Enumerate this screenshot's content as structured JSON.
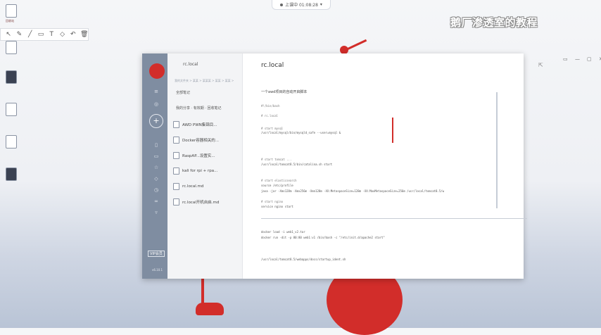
{
  "recorder": {
    "status_text": "上课中 01:08:28",
    "chevron": "▾"
  },
  "overlay_title": "鹅厂渗透室的教程",
  "anno_toolbar": {
    "tools": [
      "↖",
      "✎",
      "╱",
      "▭",
      "T",
      "◇",
      "↶",
      "🗑"
    ]
  },
  "desktop": {
    "icons": [
      {
        "label": "回收站"
      },
      {
        "label": ""
      },
      {
        "label": ""
      },
      {
        "label": ""
      },
      {
        "label": ""
      },
      {
        "label": ""
      }
    ]
  },
  "app": {
    "notebook_title": "rc.local",
    "crumb": "我的文件夹 > 某某 > 某某某 > 某某 > 某某 >",
    "section_all": "全部笔记",
    "section_recent": "我的分享 · 有效期 · 回收笔记",
    "notes": [
      {
        "title": "AWD PWN集锦目..."
      },
      {
        "title": "Docker容器相关的..."
      },
      {
        "title": "RaspAP...设置实..."
      },
      {
        "title": "kali for rpi + rpa..."
      },
      {
        "title": "rc.local.md"
      },
      {
        "title": "rc.local开机自启.md"
      }
    ],
    "rail": {
      "vip": "VIP会员",
      "version": "v6.10.1"
    },
    "editor": {
      "doc_title": "rc.local",
      "heading": "一个awd项目的自动开启脚本",
      "lines": [
        "#!/bin/bash",
        "# rc.local",
        "# start mysql",
        "/usr/local/mysql/bin/mysqld_safe --user=mysql &",
        "# start tomcat ...",
        "/usr/local/tomcat8.5/bin/catalina.sh start",
        "# start elasticsearch",
        "source /etc/profile",
        "java -jar -Xms128m -Xmx256m -Xmn128m -XX:MetaspaceSize=128m -XX:MaxMetaspaceSize=256m /usr/local/tomcat8.5/w",
        "# start nginx",
        "service nginx start",
        "docker load -i web1_v2.tar",
        "docker run -dit -p 80:80 web1:v1 /bin/bash -c \"/etc/init.d/apache2 start\"",
        "/usr/local/tomcat8.5/webapps/docs/startup_ident.sh"
      ]
    },
    "window_controls": [
      "▭",
      "—",
      "▢",
      "✕"
    ],
    "right_tools": [
      "⎘",
      "⤴",
      "⇪",
      "ⓘ",
      "⊞"
    ]
  }
}
